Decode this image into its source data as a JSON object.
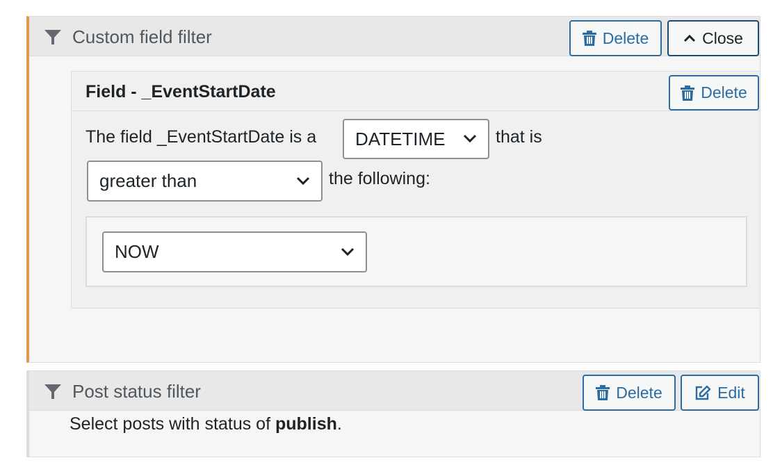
{
  "custom_filter": {
    "title": "Custom field filter",
    "delete_label": "Delete",
    "close_label": "Close",
    "field": {
      "title": "Field - _EventStartDate",
      "delete_label": "Delete",
      "sentence_start": "The field _EventStartDate is a",
      "type_select": {
        "value": "DATETIME"
      },
      "sentence_middle": "that is",
      "operator_select": {
        "value": "greater than"
      },
      "sentence_end": "the following:",
      "value_select": {
        "value": "NOW"
      }
    }
  },
  "post_status_filter": {
    "title": "Post status filter",
    "delete_label": "Delete",
    "edit_label": "Edit",
    "description_prefix": "Select posts with status of ",
    "status": "publish",
    "description_suffix": "."
  },
  "colors": {
    "accent_border": "#e49a4c",
    "link_blue": "#2b6ca3",
    "header_bg": "#e8e8e8",
    "panel_bg": "#f6f6f6"
  },
  "icons": {
    "filter": "funnel-icon",
    "delete": "trash-icon",
    "close": "chevron-up-icon",
    "edit": "edit-icon",
    "select": "chevron-down-icon"
  }
}
